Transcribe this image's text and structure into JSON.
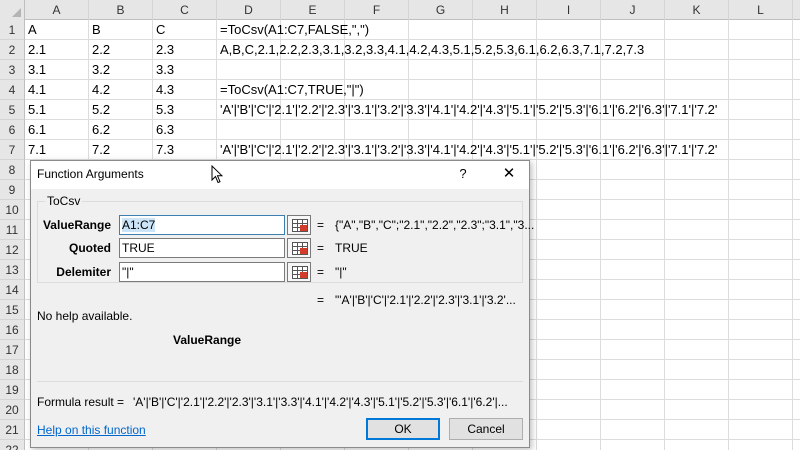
{
  "sheet": {
    "columns": [
      "A",
      "B",
      "C",
      "D",
      "E",
      "F",
      "G",
      "H",
      "I",
      "J",
      "K",
      "L"
    ],
    "rows": [
      "1",
      "2",
      "3",
      "4",
      "5",
      "6",
      "7",
      "8",
      "9",
      "10",
      "11",
      "12",
      "13",
      "14",
      "15",
      "16",
      "17",
      "18",
      "19",
      "20",
      "21",
      "22"
    ],
    "cells": {
      "A1": "A",
      "B1": "B",
      "C1": "C",
      "D1": "=ToCsv(A1:C7,FALSE,\",\")",
      "A2": "2.1",
      "B2": "2.2",
      "C2": "2.3",
      "D2": "A,B,C,2.1,2.2,2.3,3.1,3.2,3.3,4.1,4.2,4.3,5.1,5.2,5.3,6.1,6.2,6.3,7.1,7.2,7.3",
      "A3": "3.1",
      "B3": "3.2",
      "C3": "3.3",
      "A4": "4.1",
      "B4": "4.2",
      "C4": "4.3",
      "D4": "=ToCsv(A1:C7,TRUE,\"|\")",
      "A5": "5.1",
      "B5": "5.2",
      "C5": "5.3",
      "D5": "'A'|'B'|'C'|'2.1'|'2.2'|'2.3'|'3.1'|'3.2'|'3.3'|'4.1'|'4.2'|'4.3'|'5.1'|'5.2'|'5.3'|'6.1'|'6.2'|'6.3'|'7.1'|'7.2'",
      "A6": "6.1",
      "B6": "6.2",
      "C6": "6.3",
      "A7": "7.1",
      "B7": "7.2",
      "C7": "7.3",
      "D7": "'A'|'B'|'C'|'2.1'|'2.2'|'2.3'|'3.1'|'3.2'|'3.3'|'4.1'|'4.2'|'4.3'|'5.1'|'5.2'|'5.3'|'6.1'|'6.2'|'6.3'|'7.1'|'7.2'"
    }
  },
  "dialog": {
    "title": "Function Arguments",
    "help_glyph": "?",
    "close_glyph": "✕",
    "function_name": "ToCsv",
    "args": [
      {
        "label": "ValueRange",
        "value": "A1:C7",
        "result": "{\"A\",\"B\",\"C\";\"2.1\",\"2.2\",\"2.3\";\"3.1\",\"3..."
      },
      {
        "label": "Quoted",
        "value": "TRUE",
        "result": "TRUE"
      },
      {
        "label": "Delemiter",
        "value": "\"|\"",
        "result": "\"|\""
      }
    ],
    "equals": "=",
    "function_result": "\"'A'|'B'|'C'|'2.1'|'2.2'|'2.3'|'3.1'|'3.2'...",
    "no_help": "No help available.",
    "current_arg": "ValueRange",
    "formula_result_label": "Formula result =",
    "formula_result": "'A'|'B'|'C'|'2.1'|'2.2'|'2.3'|'3.1'|'3.3'|'4.1'|'4.2'|'4.3'|'5.1'|'5.2'|'5.3'|'6.1'|'6.2'|...",
    "help_link": "Help on this function",
    "ok_label": "OK",
    "cancel_label": "Cancel"
  }
}
